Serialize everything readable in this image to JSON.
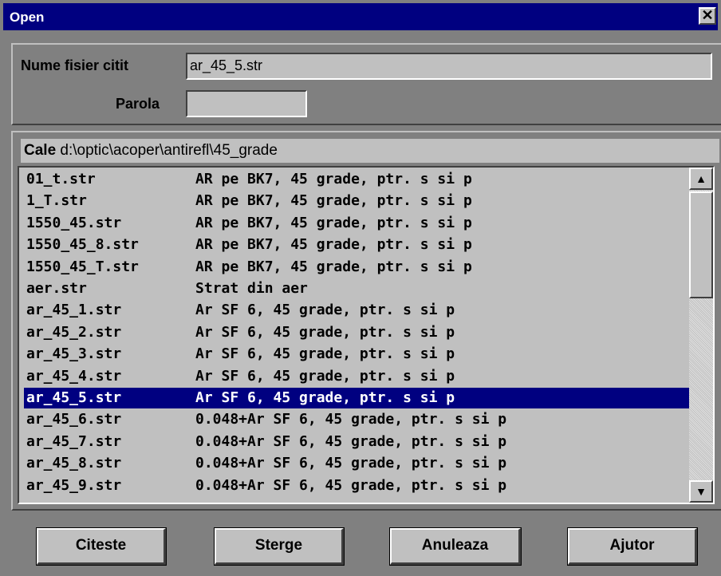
{
  "window": {
    "title": "Open",
    "close_glyph": "✕"
  },
  "form": {
    "filename_label": "Nume fisier citit",
    "filename_value": "ar_45_5.str",
    "password_label": "Parola",
    "password_value": ""
  },
  "path": {
    "label": "Cale",
    "value": "d:\\optic\\acoper\\antirefl\\45_grade"
  },
  "files": [
    {
      "name": "01_t.str",
      "desc": "AR pe BK7, 45 grade, ptr. s si p"
    },
    {
      "name": "1_T.str",
      "desc": "AR pe BK7, 45 grade, ptr. s si p"
    },
    {
      "name": "1550_45.str",
      "desc": "AR pe BK7, 45 grade, ptr. s si p"
    },
    {
      "name": "1550_45_8.str",
      "desc": "AR pe BK7, 45 grade, ptr. s si p"
    },
    {
      "name": "1550_45_T.str",
      "desc": "AR pe BK7, 45 grade, ptr. s si p"
    },
    {
      "name": "aer.str",
      "desc": "Strat din aer"
    },
    {
      "name": "ar_45_1.str",
      "desc": "Ar SF 6, 45 grade, ptr. s si p"
    },
    {
      "name": "ar_45_2.str",
      "desc": "Ar SF 6, 45 grade, ptr. s si p"
    },
    {
      "name": "ar_45_3.str",
      "desc": "Ar SF 6, 45 grade, ptr. s si p"
    },
    {
      "name": "ar_45_4.str",
      "desc": "Ar SF 6, 45 grade, ptr. s si p"
    },
    {
      "name": "ar_45_5.str",
      "desc": "Ar SF 6, 45 grade, ptr. s si p",
      "selected": true
    },
    {
      "name": "ar_45_6.str",
      "desc": "0.048+Ar SF 6, 45 grade, ptr. s si p"
    },
    {
      "name": "ar_45_7.str",
      "desc": "0.048+Ar SF 6, 45 grade, ptr. s si p"
    },
    {
      "name": "ar_45_8.str",
      "desc": "0.048+Ar SF 6, 45 grade, ptr. s si p"
    },
    {
      "name": "ar_45_9.str",
      "desc": "0.048+Ar SF 6, 45 grade, ptr. s si p"
    }
  ],
  "scrollbar": {
    "up_icon": "▲",
    "down_icon": "▼"
  },
  "buttons": {
    "read": "Citeste",
    "delete": "Sterge",
    "cancel": "Anuleaza",
    "help": "Ajutor"
  },
  "colors": {
    "titlebar": "#000080",
    "selection": "#000080",
    "face": "#c0c0c0"
  }
}
